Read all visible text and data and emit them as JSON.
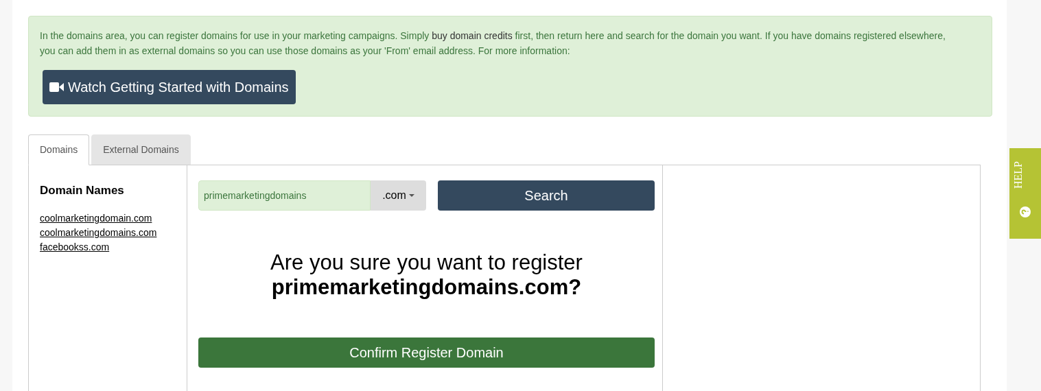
{
  "intro": {
    "text_before": "In the domains area, you can register domains for use in your marketing campaigns. Simply ",
    "link": "buy domain credits",
    "text_after": " first, then return here and search for the domain you want. If you have domains registered elsewhere, you can add them in as external domains so you can use those domains as your 'From' email address. For more information:",
    "video_button": "Watch Getting Started with Domains"
  },
  "tabs": [
    {
      "label": "Domains",
      "selected": true
    },
    {
      "label": "External Domains",
      "selected": false
    }
  ],
  "sidebar": {
    "title": "Domain Names",
    "items": [
      "coolmarketingdomain.com",
      "coolmarketingdomains.com",
      "facebookss.com"
    ]
  },
  "search": {
    "value": "primemarketingdomains",
    "tld": ".com",
    "button": "Search"
  },
  "confirm": {
    "question": "Are you sure you want to register",
    "domain": "primemarketingdomains.com?",
    "button": "Confirm Register Domain"
  },
  "help_tab": {
    "label": "HELP"
  }
}
